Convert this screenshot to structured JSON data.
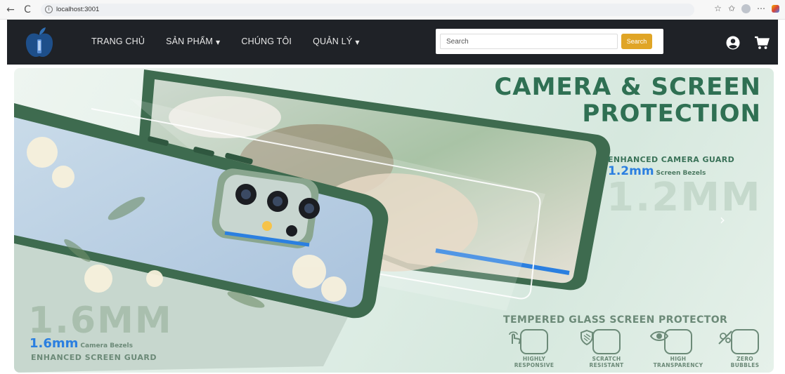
{
  "browser": {
    "back_icon": "←",
    "reload_icon": "C",
    "url": "localhost:3001",
    "info_icon": "i"
  },
  "nav": {
    "menu": [
      {
        "label": "TRANG CHỦ",
        "dropdown": false
      },
      {
        "label": "SẢN PHẨM",
        "dropdown": true
      },
      {
        "label": "CHÚNG TÔI",
        "dropdown": false
      },
      {
        "label": "QUẢN LÝ",
        "dropdown": true
      }
    ],
    "caret": "▼",
    "search": {
      "placeholder": "Search",
      "button_label": "Search"
    },
    "colors": {
      "navbar_bg": "#1f2227",
      "search_button": "#e0a526"
    }
  },
  "hero": {
    "title_line1": "CAMERA & SCREEN",
    "title_line2": "PROTECTION",
    "camera_guard_label": "ENHANCED CAMERA GUARD",
    "screen_bezel_value": "1.2mm",
    "screen_bezel_label": "Screen Bezels",
    "screen_big": "1.2MM",
    "camera_big": "1.6MM",
    "camera_bezel_value": "1.6mm",
    "camera_bezel_label": "Camera Bezels",
    "screen_guard_label": "ENHANCED SCREEN GUARD",
    "tempered_label": "TEMPERED GLASS SCREEN PROTECTOR",
    "features": [
      {
        "line1": "HIGHLY",
        "line2": "RESPONSIVE",
        "icon": "touch-icon"
      },
      {
        "line1": "SCRATCH",
        "line2": "RESISTANT",
        "icon": "shield-icon"
      },
      {
        "line1": "HIGH",
        "line2": "TRANSPARENCY",
        "icon": "eye-icon"
      },
      {
        "line1": "ZERO",
        "line2": "BUBBLES",
        "icon": "no-bubbles-icon"
      }
    ],
    "next_arrow": "›",
    "colors": {
      "accent_blue": "#2b7fe0",
      "green": "#2f7053",
      "case_green": "#3e6b4f"
    }
  }
}
